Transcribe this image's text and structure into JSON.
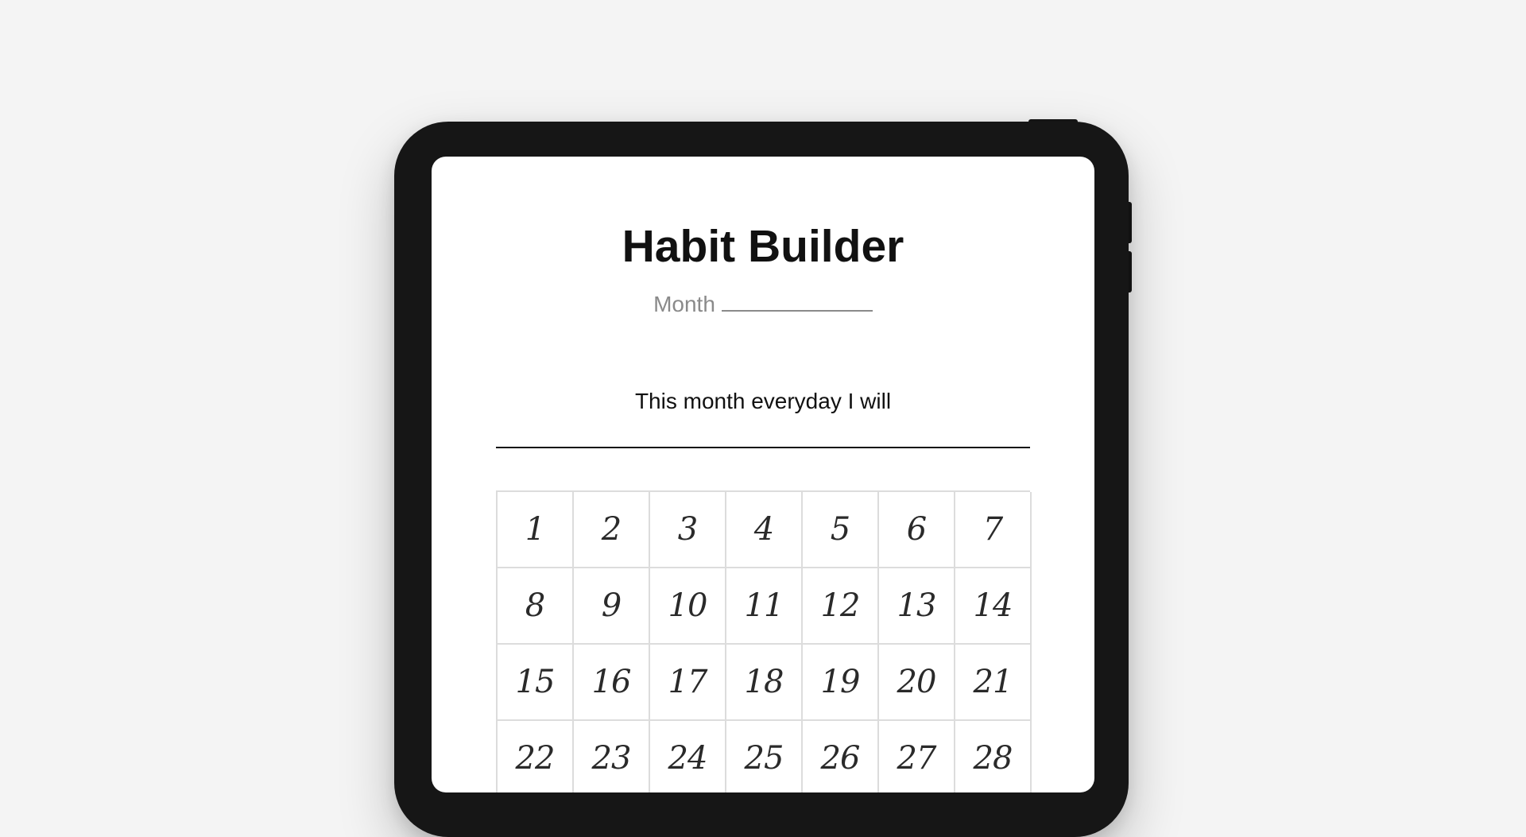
{
  "page": {
    "background_color": "#f4f4f4",
    "device_frame_color": "#161616",
    "screen_color": "#ffffff"
  },
  "tracker": {
    "title": "Habit Builder",
    "month_label": "Month",
    "prompt": "This month everyday I will",
    "days": [
      "1",
      "2",
      "3",
      "4",
      "5",
      "6",
      "7",
      "8",
      "9",
      "10",
      "11",
      "12",
      "13",
      "14",
      "15",
      "16",
      "17",
      "18",
      "19",
      "20",
      "21",
      "22",
      "23",
      "24",
      "25",
      "26",
      "27",
      "28"
    ]
  }
}
